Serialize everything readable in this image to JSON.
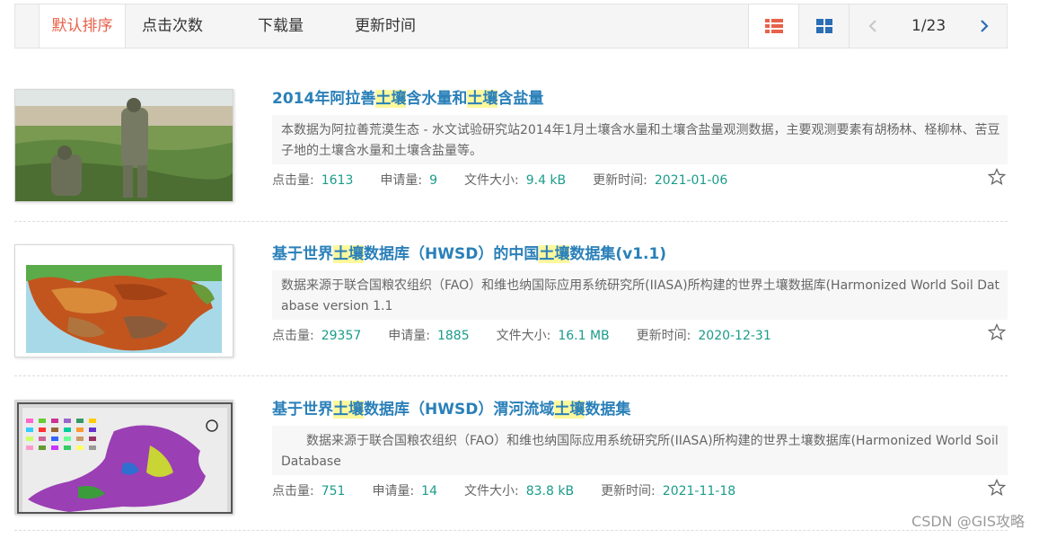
{
  "sort": {
    "options": [
      "默认排序",
      "点击次数",
      "下载量",
      "更新时间"
    ],
    "active_index": 0
  },
  "pager": {
    "text": "1/23"
  },
  "meta_labels": {
    "clicks": "点击量:",
    "requests": "申请量:",
    "size": "文件大小:",
    "updated": "更新时间:"
  },
  "items": [
    {
      "title_parts": [
        "2014年阿拉善",
        "土壤",
        "含水量和",
        "土壤",
        "含盐量"
      ],
      "desc": "本数据为阿拉善荒漠生态 - 水文试验研究站2014年1月土壤含水量和土壤含盐量观测数据，主要观测要素有胡杨林、柽柳林、苦豆子地的土壤含水量和土壤含盐量等。",
      "clicks": "1613",
      "requests": "9",
      "size": "9.4 kB",
      "updated": "2021-01-06"
    },
    {
      "title_parts": [
        "基于世界",
        "土壤",
        "数据库（HWSD）的中国",
        "土壤",
        "数据集(v1.1)"
      ],
      "desc": "数据来源于联合国粮农组织（FAO）和维也纳国际应用系统研究所(IIASA)所构建的世界土壤数据库(Harmonized World Soil Database version 1.1",
      "clicks": "29357",
      "requests": "1885",
      "size": "16.1 MB",
      "updated": "2020-12-31"
    },
    {
      "title_parts": [
        "基于世界",
        "土壤",
        "数据库（HWSD）渭河流域",
        "土壤",
        "数据集"
      ],
      "desc": "　　数据来源于联合国粮农组织（FAO）和维也纳国际应用系统研究所(IIASA)所构建的世界土壤数据库(Harmonized World Soil Database",
      "clicks": "751",
      "requests": "14",
      "size": "83.8 kB",
      "updated": "2021-11-18"
    }
  ],
  "watermark": "CSDN @GIS攻略"
}
